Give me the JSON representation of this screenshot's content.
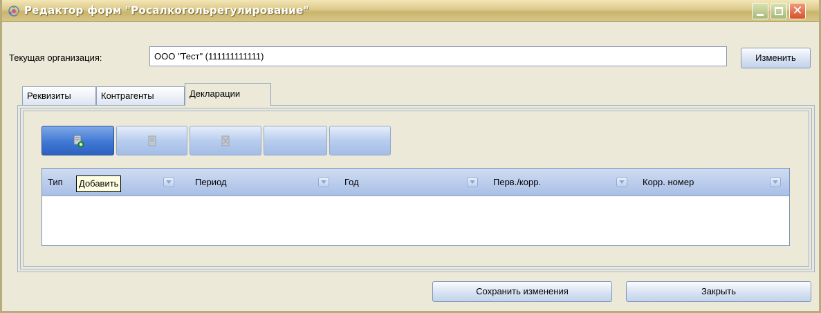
{
  "window": {
    "title": "Редактор форм \"Росалкогольрегулирование\"",
    "minimize_icon": "minimize-icon",
    "maximize_icon": "maximize-icon",
    "close_icon": "close-icon",
    "close_glyph": "✕"
  },
  "org": {
    "label": "Текущая организация:",
    "value": "ООО \"Тест\" (111111111111)",
    "change_button": "Изменить"
  },
  "tabs": [
    {
      "label": "Реквизиты"
    },
    {
      "label": "Контрагенты"
    },
    {
      "label": "Декларации",
      "selected": true
    }
  ],
  "toolbar": {
    "buttons": [
      {
        "icon": "add-document-icon",
        "active": true
      },
      {
        "icon": "edit-document-icon",
        "active": false
      },
      {
        "icon": "delete-document-icon",
        "active": false
      },
      {
        "icon": "",
        "active": false
      },
      {
        "icon": "",
        "active": false
      }
    ]
  },
  "grid": {
    "columns": [
      "Тип",
      "Период",
      "Год",
      "Перв./корр.",
      "Корр. номер"
    ],
    "rows": []
  },
  "tooltip": {
    "text": "Добавить"
  },
  "footer": {
    "save_button": "Сохранить изменения",
    "close_button": "Закрыть"
  }
}
